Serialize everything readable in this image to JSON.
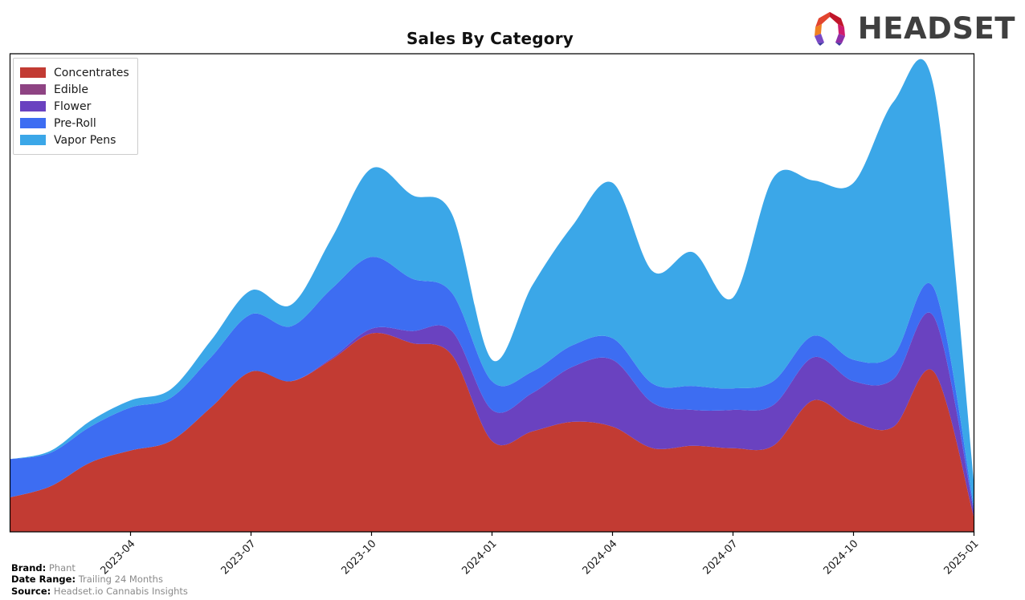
{
  "header": {
    "title": "Sales By Category",
    "logo_text": "HEADSET",
    "logo_icon": "headset-hexagon-ring-logo"
  },
  "legend": {
    "position": "top-left",
    "items": [
      {
        "label": "Concentrates",
        "color": "#c23b33"
      },
      {
        "label": "Edible",
        "color": "#8e4383"
      },
      {
        "label": "Flower",
        "color": "#6a42c0"
      },
      {
        "label": "Pre-Roll",
        "color": "#3d6df2"
      },
      {
        "label": "Vapor Pens",
        "color": "#3ba7e8"
      }
    ]
  },
  "footer": {
    "rows": [
      {
        "key": "Brand:",
        "value": "Phant"
      },
      {
        "key": "Date Range:",
        "value": "Trailing 24 Months"
      },
      {
        "key": "Source:",
        "value": "Headset.io Cannabis Insights"
      }
    ]
  },
  "chart_data": {
    "type": "area",
    "stacked": true,
    "title": "Sales By Category",
    "xlabel": "",
    "ylabel": "",
    "grid": false,
    "legend_position": "top-left",
    "x": [
      "2023-01",
      "2023-02",
      "2023-03",
      "2023-04",
      "2023-05",
      "2023-06",
      "2023-07",
      "2023-08",
      "2023-09",
      "2023-10",
      "2023-11",
      "2023-12",
      "2024-01",
      "2024-02",
      "2024-03",
      "2024-04",
      "2024-05",
      "2024-06",
      "2024-07",
      "2024-08",
      "2024-09",
      "2024-10",
      "2024-11",
      "2024-12",
      "2025-01"
    ],
    "xticklabels": [
      "2023-04",
      "2023-07",
      "2023-10",
      "2024-01",
      "2024-04",
      "2024-07",
      "2024-10",
      "2025-01"
    ],
    "xtick_positions": [
      3,
      6,
      9,
      12,
      15,
      18,
      21,
      24
    ],
    "xtick_rotation": -45,
    "yaxis_visible": false,
    "ylim": [
      0,
      100
    ],
    "series": [
      {
        "name": "Concentrates",
        "color": "#c23b33",
        "values": [
          7.2,
          9.5,
          14.5,
          17.0,
          19.0,
          26.0,
          33.5,
          31.5,
          36.0,
          41.5,
          39.5,
          37.0,
          19.0,
          21.0,
          23.0,
          22.0,
          17.5,
          18.0,
          17.5,
          18.0,
          27.5,
          23.0,
          22.0,
          33.5,
          3.0
        ]
      },
      {
        "name": "Edible",
        "color": "#8e4383",
        "values": [
          0.0,
          0.0,
          0.0,
          0.0,
          0.0,
          0.0,
          0.0,
          0.0,
          0.0,
          0.0,
          0.0,
          0.0,
          0.0,
          0.0,
          0.0,
          0.0,
          0.0,
          0.0,
          0.0,
          0.0,
          0.0,
          0.0,
          0.0,
          0.0,
          0.0
        ]
      },
      {
        "name": "Flower",
        "color": "#6a42c0",
        "values": [
          0.0,
          0.0,
          0.0,
          0.0,
          0.0,
          0.0,
          0.0,
          0.0,
          0.3,
          1.0,
          2.5,
          5.0,
          6.5,
          8.0,
          11.5,
          14.0,
          9.5,
          7.5,
          8.0,
          8.5,
          9.0,
          8.5,
          10.0,
          11.5,
          1.2
        ]
      },
      {
        "name": "Pre-Roll",
        "color": "#3d6df2",
        "values": [
          8.0,
          7.0,
          7.5,
          9.0,
          9.0,
          10.5,
          12.0,
          11.5,
          14.5,
          15.0,
          11.0,
          8.0,
          6.0,
          4.5,
          4.5,
          4.5,
          4.0,
          5.0,
          4.5,
          5.0,
          4.5,
          4.5,
          5.0,
          6.0,
          0.9
        ]
      },
      {
        "name": "Vapor Pens",
        "color": "#3ba7e8",
        "values": [
          0.0,
          0.4,
          1.2,
          1.5,
          1.8,
          3.5,
          5.0,
          4.5,
          10.5,
          18.5,
          17.5,
          16.5,
          4.5,
          18.0,
          25.0,
          32.5,
          23.5,
          28.0,
          19.0,
          42.5,
          32.5,
          37.0,
          53.0,
          42.0,
          5.0
        ]
      }
    ],
    "totals": [
      15.2,
      16.9,
      23.2,
      27.5,
      29.8,
      40.0,
      50.5,
      47.5,
      61.3,
      76.0,
      70.5,
      66.5,
      36.0,
      51.5,
      64.0,
      73.0,
      54.5,
      58.5,
      49.0,
      74.0,
      73.5,
      73.0,
      90.0,
      93.0,
      10.1
    ]
  }
}
